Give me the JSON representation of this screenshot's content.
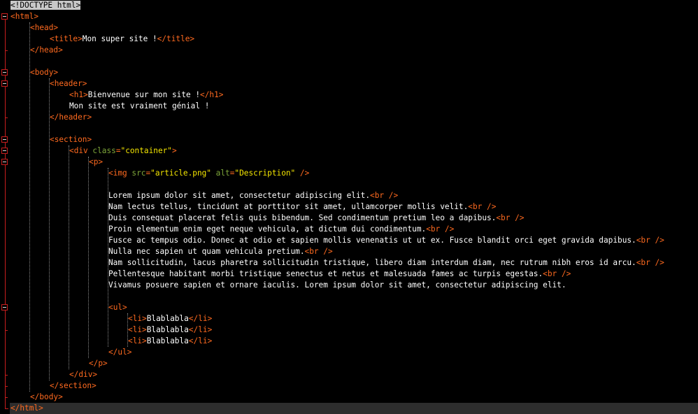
{
  "colors": {
    "background": "#000000",
    "tag": "#ff6a1f",
    "attribute": "#7fa83a",
    "string": "#f5e600",
    "text": "#ffffff",
    "fold_marker": "#c81e1e",
    "caret_line": "#2d2d2d"
  },
  "code": {
    "doctype": "<!DOCTYPE html>",
    "html_tag": "html",
    "head_tag": "head",
    "title_tag": "title",
    "title_text": "Mon super site !",
    "body_tag": "body",
    "header_tag": "header",
    "h1_tag": "h1",
    "h1_text": "Bienvenue sur mon site !",
    "header_text": "Mon site est vraiment génial !",
    "section_tag": "section",
    "div_tag": "div",
    "div_attr": "class",
    "div_attr_value": "\"container\"",
    "p_tag": "p",
    "img_tag": "img",
    "img_src_attr": "src",
    "img_src_value": "\"article.png\"",
    "img_alt_attr": "alt",
    "img_alt_value": "\"Description\"",
    "self_close": "/>",
    "br_tag": "br",
    "paragraph_lines": [
      "Lorem ipsum dolor sit amet, consectetur adipiscing elit.",
      "Nam lectus tellus, tincidunt at porttitor sit amet, ullamcorper mollis velit.",
      "Duis consequat placerat felis quis bibendum. Sed condimentum pretium leo a dapibus.",
      "Proin elementum enim eget neque vehicula, at dictum dui condimentum.",
      "Fusce ac tempus odio. Donec at odio et sapien mollis venenatis ut ut ex. Fusce blandit orci eget gravida dapibus.",
      "Nulla nec sapien ut quam vehicula pretium.",
      "Nam sollicitudin, lacus pharetra sollicitudin tristique, libero diam interdum diam, nec rutrum nibh eros id arcu.",
      "Pellentesque habitant morbi tristique senectus et netus et malesuada fames ac turpis egestas.",
      "Vivamus posuere sapien et ornare iaculis. Lorem ipsum dolor sit amet, consectetur adipiscing elit."
    ],
    "ul_tag": "ul",
    "li_tag": "li",
    "li_items": [
      "Blablabla",
      "Blablabla",
      "Blablabla"
    ]
  }
}
